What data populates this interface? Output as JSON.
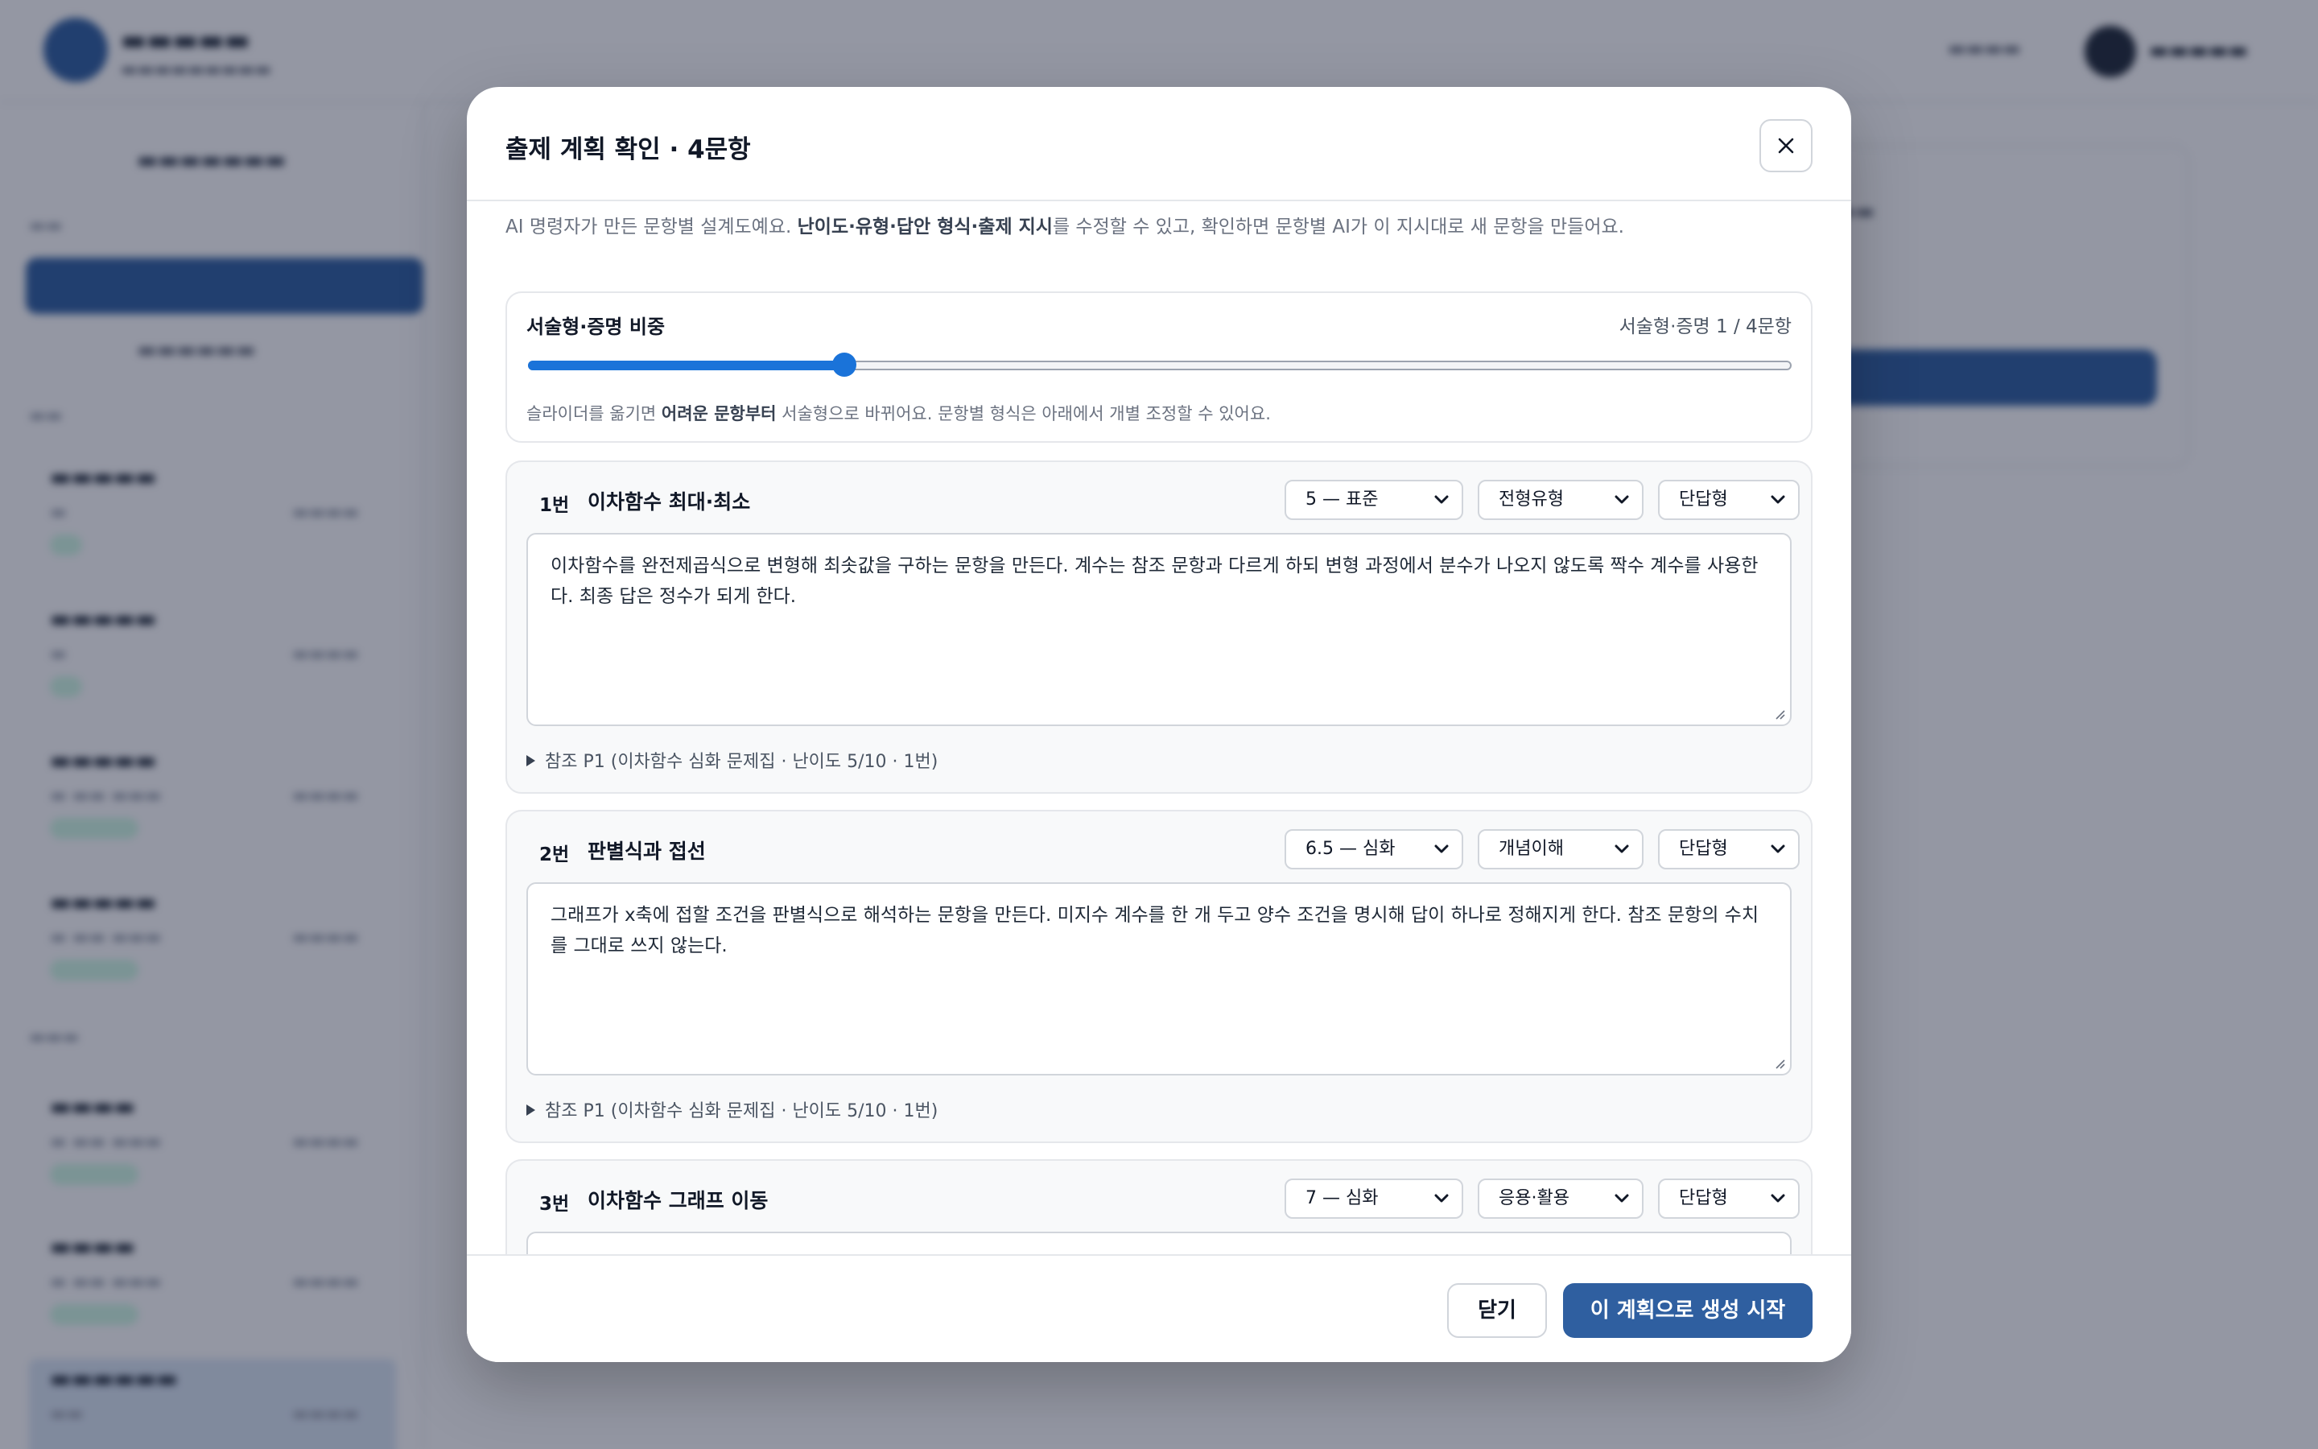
{
  "modal": {
    "title": "출제 계획 확인 · 4문항",
    "intro": {
      "prefix": "AI 명령자가 만든 문항별 설계도예요. ",
      "bold": "난이도·유형·답안 형식·출제 지시",
      "suffix": "를 수정할 수 있고, 확인하면 문항별 AI가 이 지시대로 새 문항을 만들어요."
    },
    "ratio": {
      "label": "서술형·증명 비중",
      "count": "서술형·증명 1 / 4문항",
      "value": 1,
      "max": 4,
      "hint": {
        "prefix": "슬라이더를 옮기면 ",
        "bold": "어려운 문항부터",
        "suffix": " 서술형으로 바뀌어요. 문항별 형식은 아래에서 개별 조정할 수 있어요."
      }
    },
    "items": [
      {
        "num": "1번",
        "title": "이차함수 최대·최소",
        "difficulty": "5 — 표준",
        "type": "전형유형",
        "format": "단답형",
        "directive": "이차함수를 완전제곱식으로 변형해 최솟값을 구하는 문항을 만든다. 계수는 참조 문항과 다르게 하되 변형 과정에서 분수가 나오지 않도록 짝수 계수를 사용한다. 최종 답은 정수가 되게 한다.",
        "reference": "참조 P1 (이차함수 심화 문제집 · 난이도 5/10 · 1번)"
      },
      {
        "num": "2번",
        "title": "판별식과 접선",
        "difficulty": "6.5 — 심화",
        "type": "개념이해",
        "format": "단답형",
        "directive": "그래프가 x축에 접할 조건을 판별식으로 해석하는 문항을 만든다. 미지수 계수를 한 개 두고 양수 조건을 명시해 답이 하나로 정해지게 한다. 참조 문항의 수치를 그대로 쓰지 않는다.",
        "reference": "참조 P1 (이차함수 심화 문제집 · 난이도 5/10 · 1번)"
      },
      {
        "num": "3번",
        "title": "이차함수 그래프 이동",
        "difficulty": "7 — 심화",
        "type": "응용·활용",
        "format": "단답형",
        "directive": "",
        "reference": ""
      }
    ],
    "footer": {
      "close_label": "닫기",
      "start_label": "이 계획으로 생성 시작"
    }
  },
  "colors": {
    "primary": "#2f5fa0",
    "slider": "#1a73d9",
    "overlay": "rgba(17,24,52,0.45)"
  }
}
